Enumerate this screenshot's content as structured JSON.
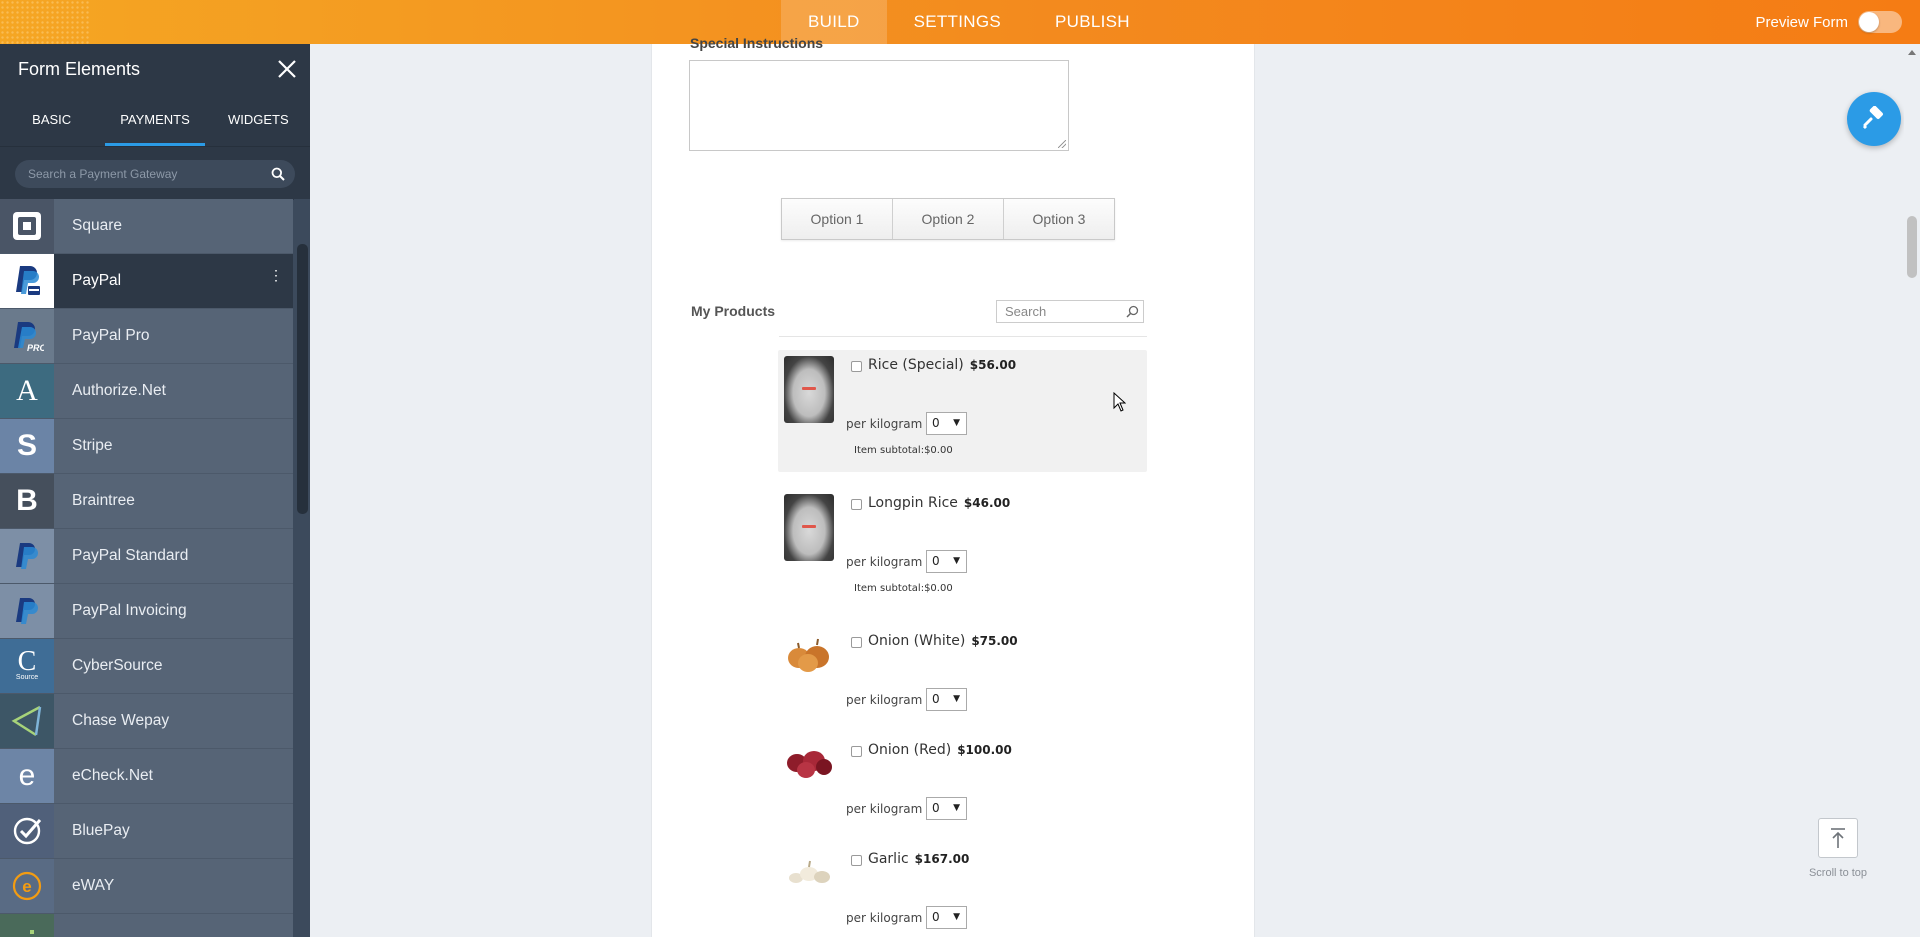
{
  "topbar": {
    "nav": [
      {
        "label": "BUILD",
        "active": true
      },
      {
        "label": "SETTINGS",
        "active": false
      },
      {
        "label": "PUBLISH",
        "active": false
      }
    ],
    "preview_label": "Preview Form",
    "preview_enabled": false,
    "colors": {
      "gradient_start": "#f5a623",
      "gradient_end": "#f57c14"
    }
  },
  "sidebar": {
    "title": "Form Elements",
    "close_icon": "close-icon",
    "tabs": [
      {
        "label": "BASIC",
        "active": false
      },
      {
        "label": "PAYMENTS",
        "active": true
      },
      {
        "label": "WIDGETS",
        "active": false
      }
    ],
    "search_placeholder": "Search a Payment Gateway",
    "items": [
      {
        "label": "Square",
        "icon": "square-icon",
        "icon_bg": "#4a5566",
        "active": false
      },
      {
        "label": "PayPal",
        "icon": "paypal-icon",
        "icon_bg": "#ffffff",
        "active": true
      },
      {
        "label": "PayPal Pro",
        "icon": "paypal-pro-icon",
        "icon_bg": "#6a7a8c",
        "active": false
      },
      {
        "label": "Authorize.Net",
        "icon": "authorize-net-icon",
        "icon_bg": "#3d6b80",
        "active": false
      },
      {
        "label": "Stripe",
        "icon": "stripe-icon",
        "icon_bg": "#6b84a6",
        "active": false
      },
      {
        "label": "Braintree",
        "icon": "braintree-icon",
        "icon_bg": "#454f5c",
        "active": false
      },
      {
        "label": "PayPal Standard",
        "icon": "paypal-standard-icon",
        "icon_bg": "#7d8fa6",
        "active": false
      },
      {
        "label": "PayPal Invoicing",
        "icon": "paypal-invoicing-icon",
        "icon_bg": "#7d8fa6",
        "active": false
      },
      {
        "label": "CyberSource",
        "icon": "cybersource-icon",
        "icon_bg": "#3f6d96",
        "active": false
      },
      {
        "label": "Chase Wepay",
        "icon": "chase-wepay-icon",
        "icon_bg": "#3d5666",
        "active": false
      },
      {
        "label": "eCheck.Net",
        "icon": "echeck-icon",
        "icon_bg": "#6d85a6",
        "active": false
      },
      {
        "label": "BluePay",
        "icon": "bluepay-icon",
        "icon_bg": "#50607a",
        "active": false
      },
      {
        "label": "eWAY",
        "icon": "eway-icon",
        "icon_bg": "#596b84",
        "active": false
      },
      {
        "label": "",
        "icon": "dots-icon",
        "icon_bg": "#4a6a5a",
        "active": false
      }
    ]
  },
  "form": {
    "special_instructions_label": "Special Instructions",
    "options": [
      "Option 1",
      "Option 2",
      "Option 3"
    ],
    "products_label": "My Products",
    "products_search_placeholder": "Search",
    "products": [
      {
        "name": "Rice (Special)",
        "price": "$56.00",
        "unit": "per kilogram",
        "qty": "0",
        "subtotal": "Item subtotal:$0.00",
        "image": "rice-bag-image",
        "highlighted": true
      },
      {
        "name": "Longpin Rice",
        "price": "$46.00",
        "unit": "per kilogram",
        "qty": "0",
        "subtotal": "Item subtotal:$0.00",
        "image": "rice-bag-image",
        "highlighted": false
      },
      {
        "name": "Onion (White)",
        "price": "$75.00",
        "unit": "per kilogram",
        "qty": "0",
        "subtotal": "",
        "image": "white-onion-image",
        "highlighted": false
      },
      {
        "name": "Onion (Red)",
        "price": "$100.00",
        "unit": "per kilogram",
        "qty": "0",
        "subtotal": "",
        "image": "red-onion-image",
        "highlighted": false
      },
      {
        "name": "Garlic",
        "price": "$167.00",
        "unit": "per kilogram",
        "qty": "0",
        "subtotal": "",
        "image": "garlic-image",
        "highlighted": false
      }
    ]
  },
  "fab_icon": "paint-roller-icon",
  "scroll_to_top_label": "Scroll to top"
}
